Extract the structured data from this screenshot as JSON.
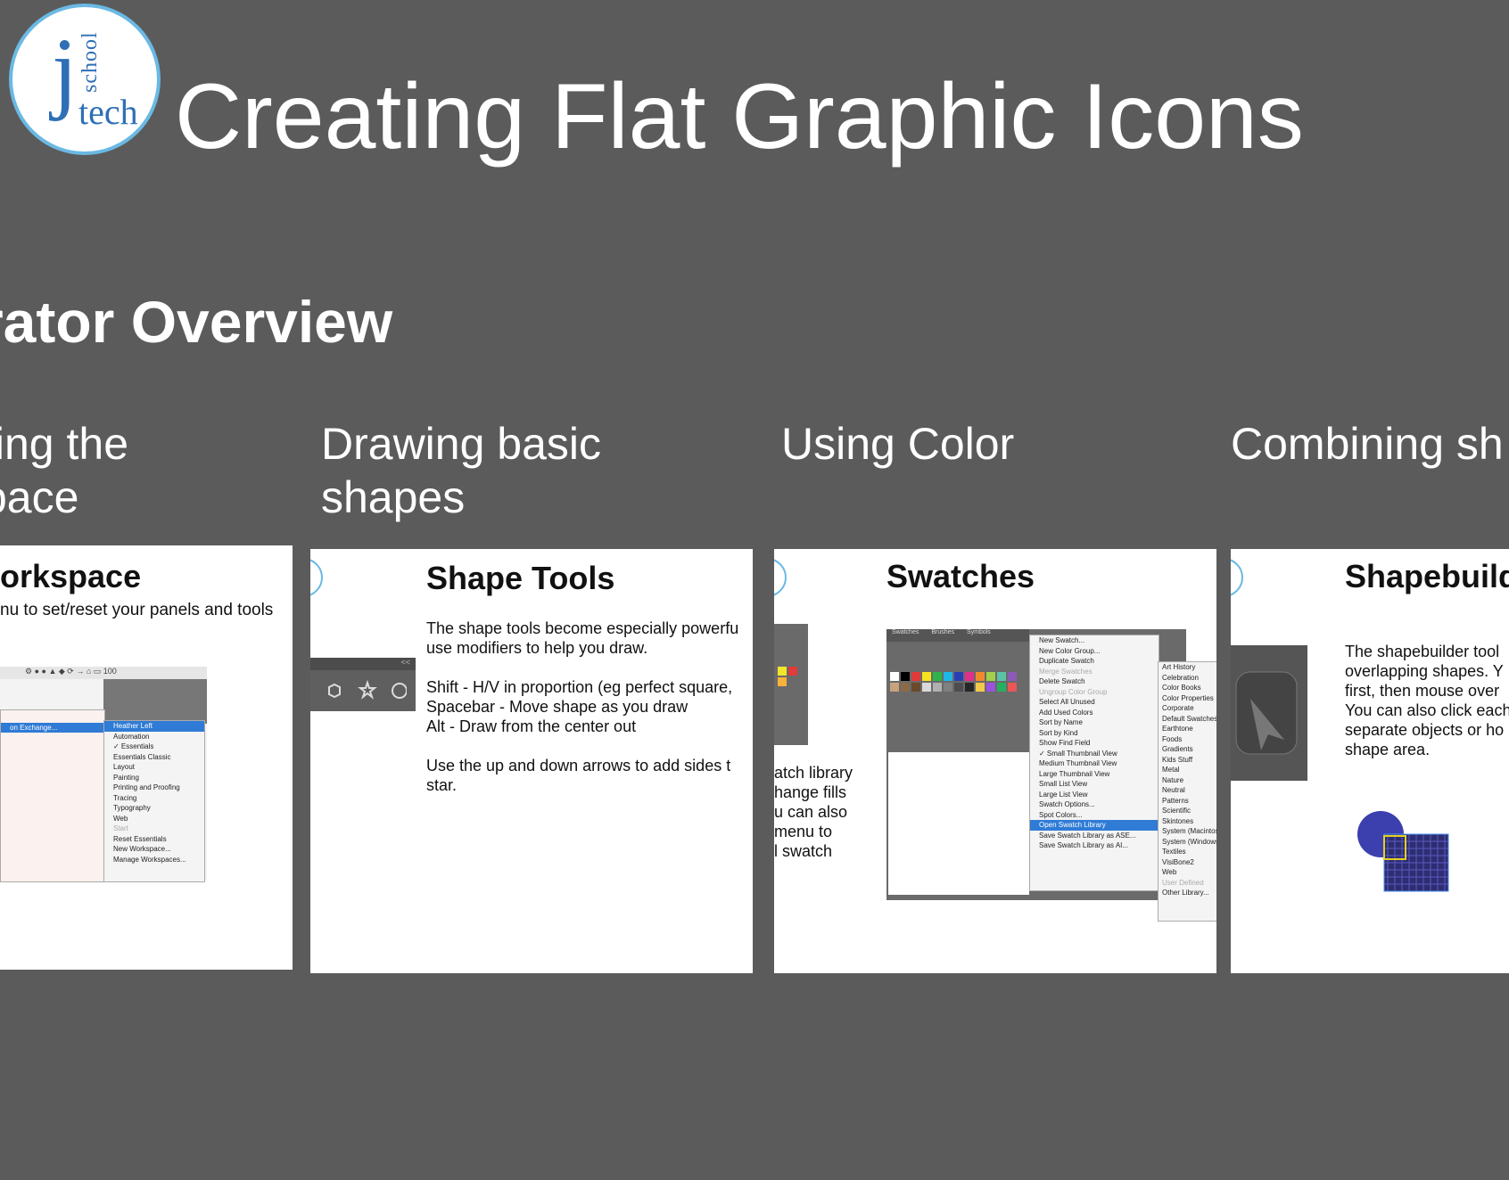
{
  "header": {
    "logo_j": "j",
    "logo_school": "school",
    "logo_tech": "tech",
    "title": "Creating Flat Graphic Icons"
  },
  "section_title": "rator Overview",
  "topics": [
    {
      "label": "ting the\npace"
    },
    {
      "label": "Drawing basic\nshapes"
    },
    {
      "label": "Using Color"
    },
    {
      "label": "Combining sh"
    }
  ],
  "slides": {
    "workspace": {
      "title": "orkspace",
      "subtitle": "nu to set/reset your panels and tools",
      "menu_left": [
        "",
        "on Exchange...",
        "",
        "",
        "",
        "",
        "",
        "",
        "",
        "",
        "",
        "",
        ""
      ],
      "menu_items": [
        "Heather Left",
        "Automation",
        "✓ Essentials",
        "Essentials Classic",
        "Layout",
        "Painting",
        "Printing and Proofing",
        "Tracing",
        "Typography",
        "Web",
        "Start",
        "Reset Essentials",
        "New Workspace...",
        "Manage Workspaces..."
      ]
    },
    "shapes": {
      "title": "Shape Tools",
      "body": "The shape tools become especially powerfu\nuse modifiers to help you draw.\n\nShift - H/V in proportion (eg perfect square,\nSpacebar - Move shape as you draw\nAlt - Draw from the center out\n\nUse the up and down arrows to add sides t\nstar."
    },
    "swatches": {
      "title": "Swatches",
      "left_text": "atch library\nhange fills\nu can also\nmenu to\nl swatch",
      "tabs": [
        "Swatches",
        "Brushes",
        "Symbols"
      ],
      "menu": [
        "New Swatch...",
        "New Color Group...",
        "Duplicate Swatch",
        "Merge Swatches",
        "Delete Swatch",
        "Ungroup Color Group",
        "Select All Unused",
        "Add Used Colors",
        "Sort by Name",
        "Sort by Kind",
        "Show Find Field",
        "✓ Small Thumbnail View",
        "Medium Thumbnail View",
        "Large Thumbnail View",
        "Small List View",
        "Large List View",
        "Swatch Options...",
        "Spot Colors...",
        "Open Swatch Library",
        "Save Swatch Library as ASE...",
        "Save Swatch Library as AI..."
      ],
      "submenu": [
        "Art History",
        "Celebration",
        "Color Books",
        "Color Properties",
        "Corporate",
        "Default Swatches",
        "Earthtone",
        "Foods",
        "Gradients",
        "Kids Stuff",
        "Metal",
        "Nature",
        "Neutral",
        "Patterns",
        "Scientific",
        "Skintones",
        "System (Macintosh)",
        "System (Windows)",
        "Textiles",
        "VisiBone2",
        "Web",
        "User Defined",
        "Other Library..."
      ]
    },
    "shapebuilder": {
      "title": "Shapebuild",
      "body": "The shapebuilder tool\noverlapping shapes. Y\nfirst, then mouse over\nYou can also click each\nseparate objects or ho\nshape area."
    }
  },
  "colors": {
    "background": "#5b5b5b",
    "logo_ring": "#6ab9e4",
    "logo_text": "#2f6fb6",
    "menu_highlight": "#2f7bd6",
    "circle": "#3c3fae",
    "square": "#2d2d72"
  }
}
